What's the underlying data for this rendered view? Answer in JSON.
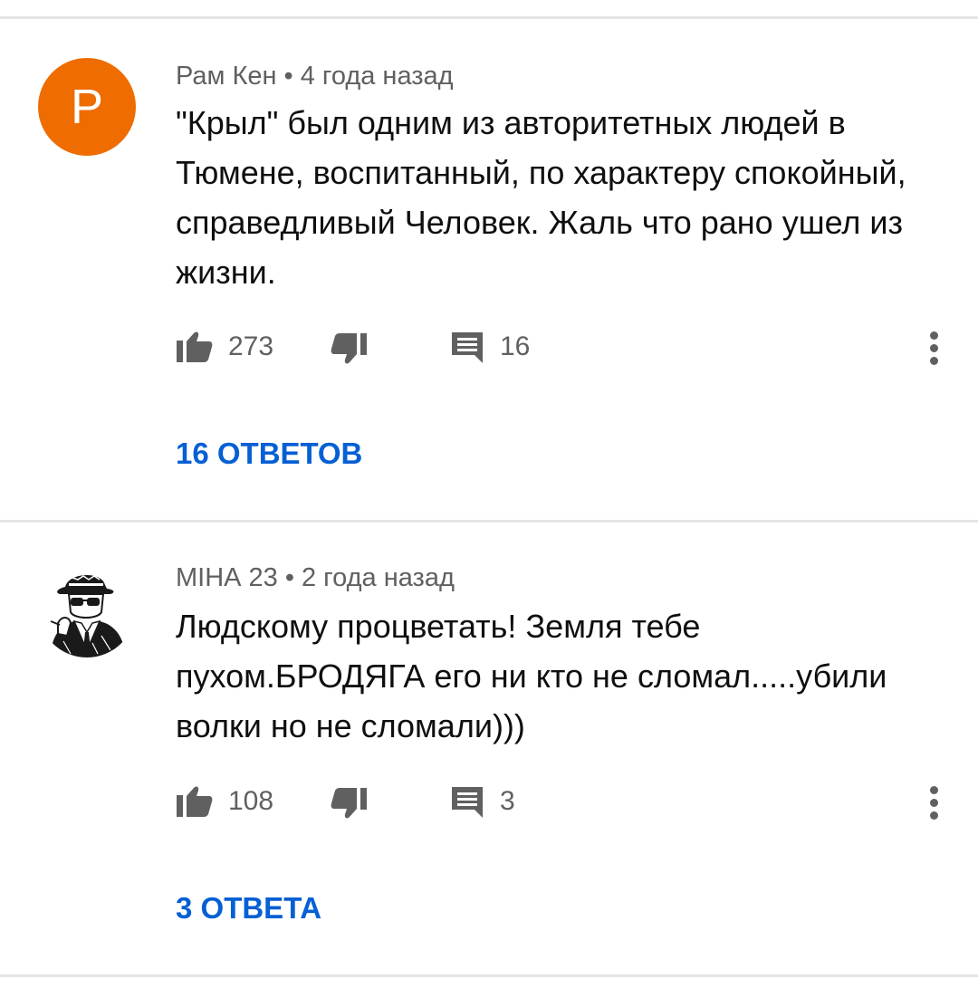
{
  "comments": [
    {
      "avatar_letter": "P",
      "avatar_color": "#ef6c00",
      "author": "Рам Кен",
      "time": "4 года назад",
      "text_lines": [
        "\"Крыл\" был одним из авторитетных людей в",
        "Тюмене, воспитанный, по характеру спокойный,",
        "справедливый Человек. Жаль что рано ушел из",
        "жизни."
      ],
      "likes": "273",
      "reply_count": "16",
      "replies_label": "16 ОТВЕТОВ"
    },
    {
      "avatar_icon": "man-in-hat-sunglasses-avatar-icon",
      "author": "МІНА 23",
      "time": "2 года назад",
      "text_lines": [
        "Людскому процветать! Земля тебе",
        "пухом.БРОДЯГА его ни кто не сломал.....убили",
        "волки но не сломали)))"
      ],
      "likes": "108",
      "reply_count": "3",
      "replies_label": "3 ОТВЕТА"
    }
  ],
  "colors": {
    "link": "#065fd4",
    "secondary_text": "#606060",
    "divider": "#e5e5e5"
  }
}
